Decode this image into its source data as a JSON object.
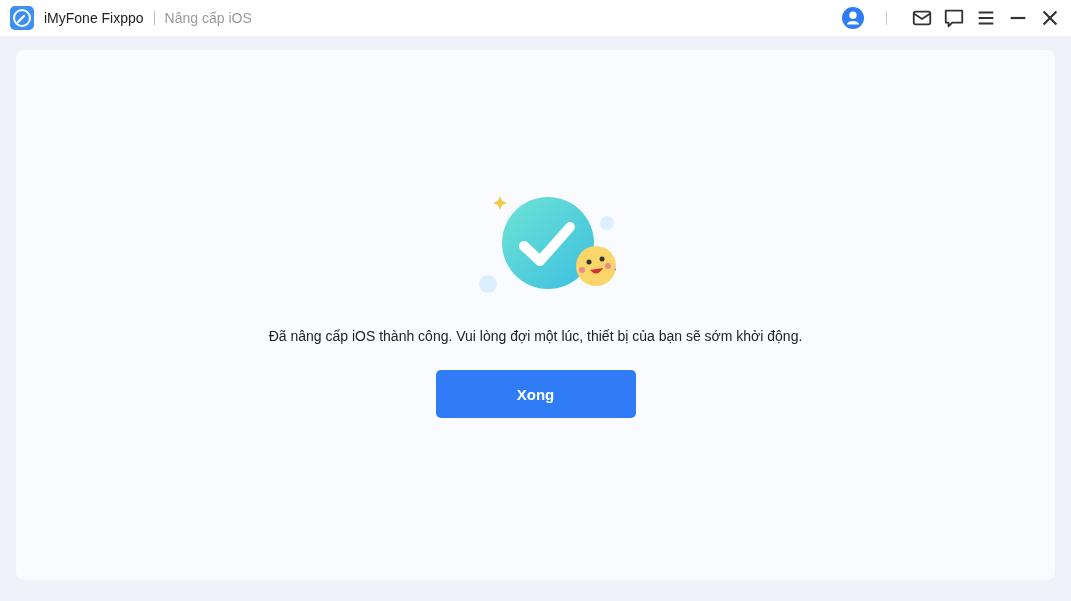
{
  "window": {
    "app_name": "iMyFone Fixppo",
    "section": "Nâng cấp iOS"
  },
  "result": {
    "message": "Đã nâng cấp iOS thành công. Vui lòng đợi một lúc, thiết bị của bạn sẽ sớm khởi động.",
    "button": "Xong"
  }
}
